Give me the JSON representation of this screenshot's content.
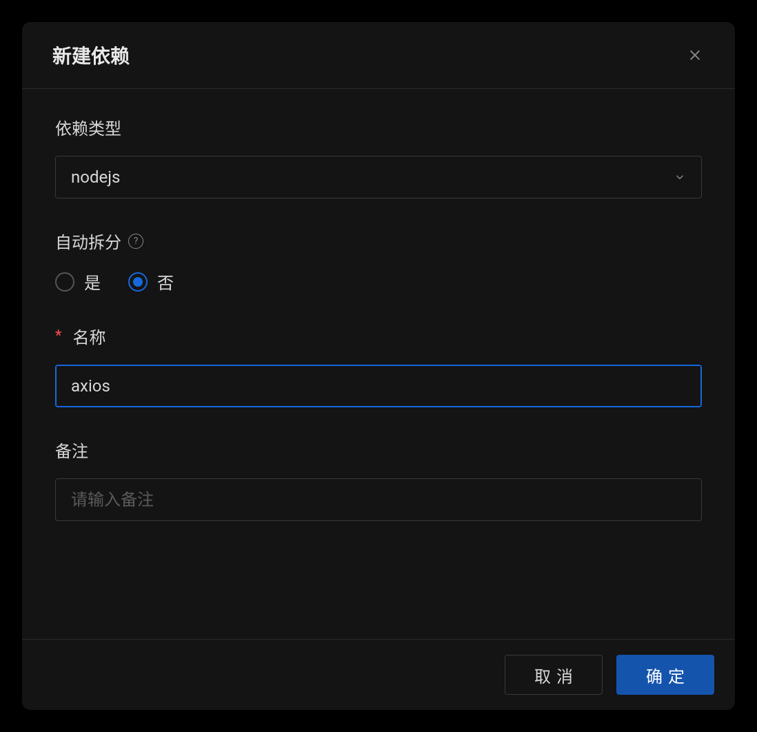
{
  "dialog": {
    "title": "新建依赖",
    "fields": {
      "type": {
        "label": "依赖类型",
        "value": "nodejs"
      },
      "autoSplit": {
        "label": "自动拆分",
        "options": {
          "yes": "是",
          "no": "否"
        },
        "selected": "no"
      },
      "name": {
        "label": "名称",
        "required": true,
        "value": "axios"
      },
      "remark": {
        "label": "备注",
        "placeholder": "请输入备注",
        "value": ""
      }
    },
    "buttons": {
      "cancel": "取消",
      "confirm": "确定"
    }
  }
}
